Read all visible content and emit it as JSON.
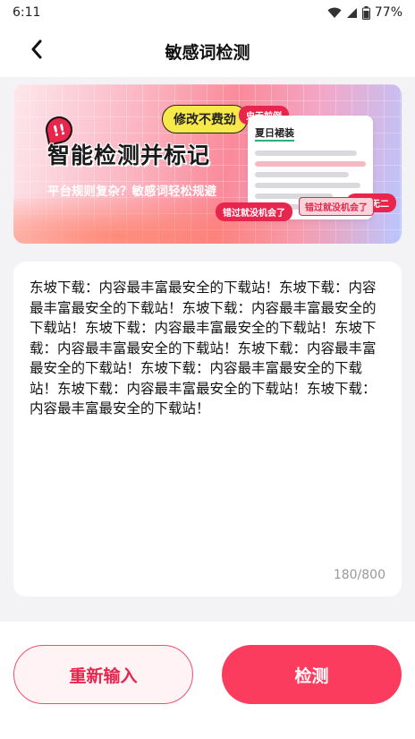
{
  "status_bar": {
    "time": "6:11",
    "battery": "77%",
    "icons": [
      "wifi-icon",
      "signal-icon",
      "battery-icon"
    ]
  },
  "nav": {
    "title": "敏感词检测",
    "back_icon": "chevron-left-icon"
  },
  "banner": {
    "headline": "智能检测并标记",
    "subline": "平台规则复杂？敏感词轻松规避",
    "free_badge": "修改不费劲",
    "tag_first": "史无前例",
    "tag_unique": "独一无二",
    "tag_miss": "错过就没机会了",
    "note_title": "夏日裙装",
    "exclaim": "!!"
  },
  "editor": {
    "text": "东坡下载：内容最丰富最安全的下载站！东坡下载：内容最丰富最安全的下载站！东坡下载：内容最丰富最安全的下载站！东坡下载：内容最丰富最安全的下载站！东坡下载：内容最丰富最安全的下载站！东坡下载：内容最丰富最安全的下载站！东坡下载：内容最丰富最安全的下载站！东坡下载：内容最丰富最安全的下载站！东坡下载：内容最丰富最安全的下载站！",
    "count": "180/800"
  },
  "footer": {
    "reset_label": "重新输入",
    "detect_label": "检测"
  },
  "colors": {
    "accent": "#fb3c5e",
    "accent_dark": "#e8254c",
    "background": "#f3f3f5"
  }
}
